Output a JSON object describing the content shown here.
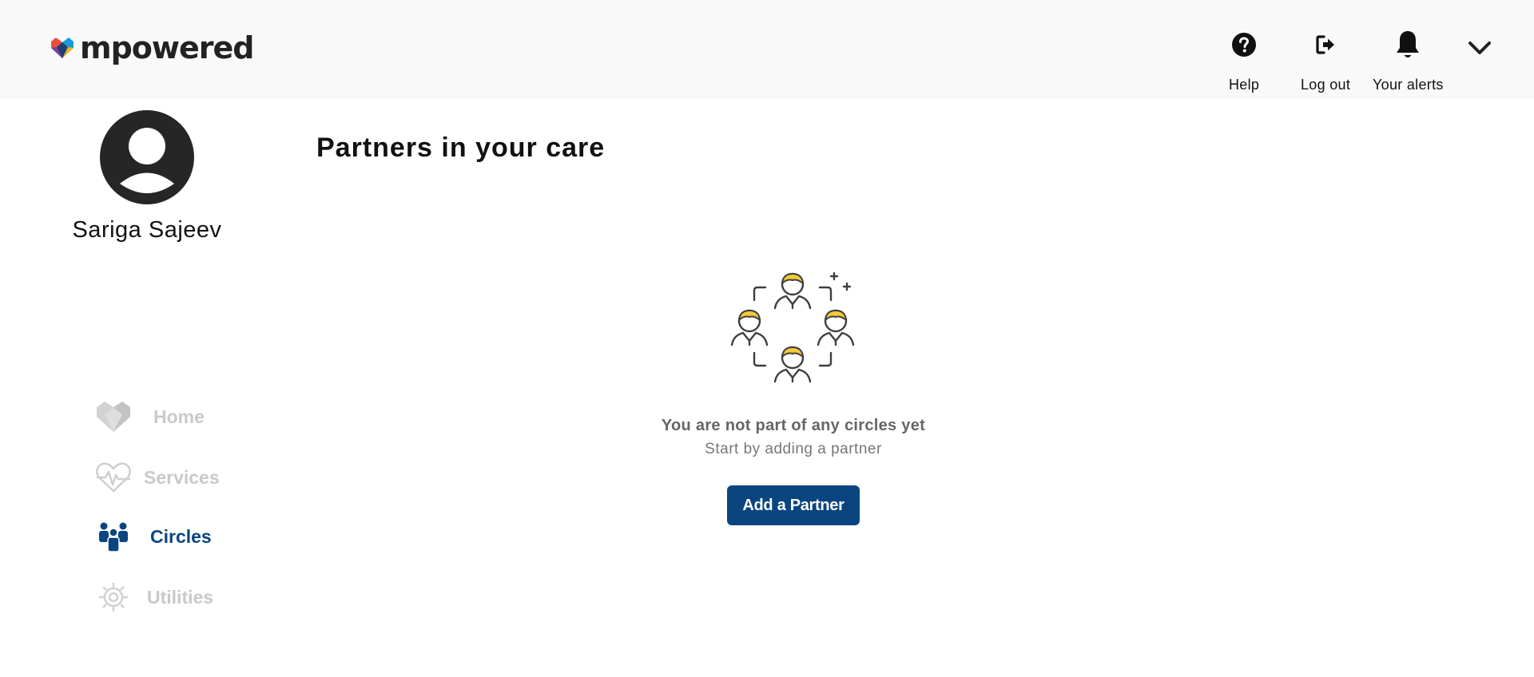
{
  "header": {
    "logo_text": "mpowered",
    "help_label": "Help",
    "logout_label": "Log out",
    "alerts_label": "Your alerts",
    "icons": [
      "help-icon",
      "logout-icon",
      "bell-icon",
      "chevron-down-icon"
    ]
  },
  "profile": {
    "name": "Sariga Sajeev"
  },
  "nav": {
    "home": "Home",
    "services": "Services",
    "circles": "Circles",
    "utilities": "Utilities",
    "active": "circles"
  },
  "main": {
    "title": "Partners in your care",
    "empty_title": "You are not part of any circles yet",
    "empty_subtitle": "Start by adding a partner",
    "add_button": "Add a Partner"
  },
  "colors": {
    "accent": "#0a4580",
    "inactive_nav": "#c9c9c9",
    "header_bg": "#f9f9f9",
    "illustration_hair": "#f5c93a"
  }
}
